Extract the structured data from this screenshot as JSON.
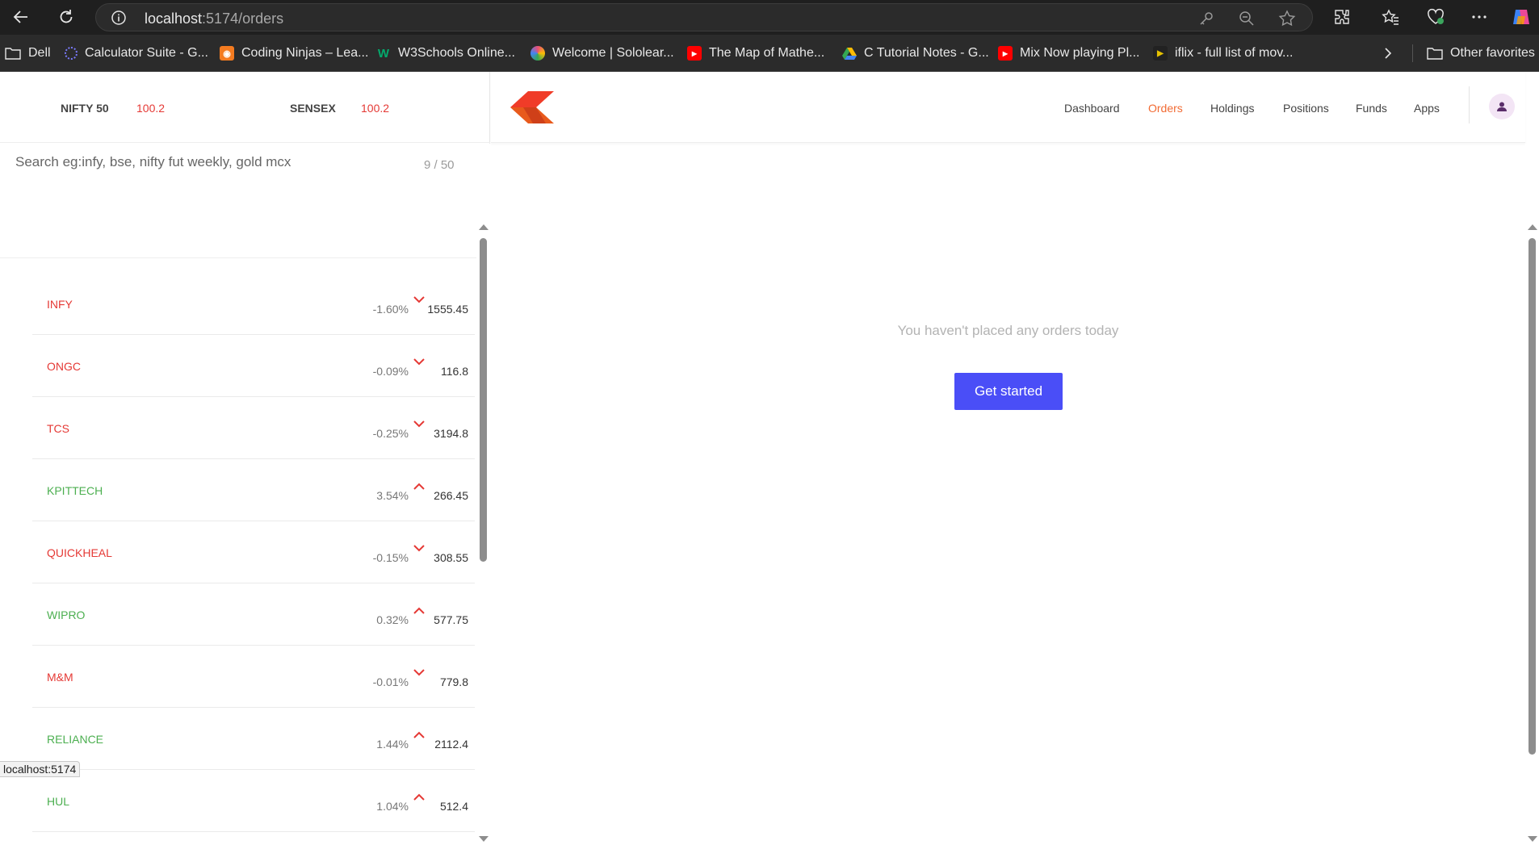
{
  "browser": {
    "url_host": "localhost",
    "url_path": ":5174/orders",
    "bookmarks": [
      {
        "label": "Dell",
        "icon": "folder-icon",
        "color": ""
      },
      {
        "label": "Calculator Suite - G...",
        "icon": "geogebra-icon",
        "color": "#7b7bff"
      },
      {
        "label": "Coding Ninjas – Lea...",
        "icon": "codingninjas-icon",
        "color": "#f47b20"
      },
      {
        "label": "W3Schools Online...",
        "icon": "w3schools-icon",
        "color": "#04aa6d"
      },
      {
        "label": "Welcome | Sololear...",
        "icon": "sololearn-icon",
        "color": "#e94e77"
      },
      {
        "label": "The Map of Mathe...",
        "icon": "youtube-icon",
        "color": "#ff0000"
      },
      {
        "label": "C Tutorial Notes - G...",
        "icon": "google-drive-icon",
        "color": "#fbbc04"
      },
      {
        "label": "Mix Now playing Pl...",
        "icon": "youtube-icon",
        "color": "#ff0000"
      },
      {
        "label": "iflix - full list of mov...",
        "icon": "iflix-icon",
        "color": "#e5c100"
      }
    ],
    "other_favorites": "Other favorites",
    "status_url": "localhost:5174"
  },
  "indices": [
    {
      "name": "NIFTY 50",
      "value": "100.2"
    },
    {
      "name": "SENSEX",
      "value": "100.2"
    }
  ],
  "search": {
    "placeholder": "Search eg:infy, bse, nifty fut weekly, gold mcx",
    "count": "9 / 50"
  },
  "watchlist": [
    {
      "symbol": "INFY",
      "percent": "-1.60%",
      "price": "1555.45",
      "direction": "down"
    },
    {
      "symbol": "ONGC",
      "percent": "-0.09%",
      "price": "116.8",
      "direction": "down"
    },
    {
      "symbol": "TCS",
      "percent": "-0.25%",
      "price": "3194.8",
      "direction": "down"
    },
    {
      "symbol": "KPITTECH",
      "percent": "3.54%",
      "price": "266.45",
      "direction": "up"
    },
    {
      "symbol": "QUICKHEAL",
      "percent": "-0.15%",
      "price": "308.55",
      "direction": "down"
    },
    {
      "symbol": "WIPRO",
      "percent": "0.32%",
      "price": "577.75",
      "direction": "up"
    },
    {
      "symbol": "M&M",
      "percent": "-0.01%",
      "price": "779.8",
      "direction": "down"
    },
    {
      "symbol": "RELIANCE",
      "percent": "1.44%",
      "price": "2112.4",
      "direction": "up"
    },
    {
      "symbol": "HUL",
      "percent": "1.04%",
      "price": "512.4",
      "direction": "up"
    }
  ],
  "nav": {
    "items": [
      "Dashboard",
      "Orders",
      "Holdings",
      "Positions",
      "Funds",
      "Apps"
    ],
    "active": "Orders"
  },
  "orders": {
    "empty_message": "You haven't placed any orders today",
    "cta_label": "Get started"
  },
  "colors": {
    "accent": "#f26b34",
    "button": "#4a4ef7",
    "down": "#e53935",
    "up": "#4caf50"
  }
}
